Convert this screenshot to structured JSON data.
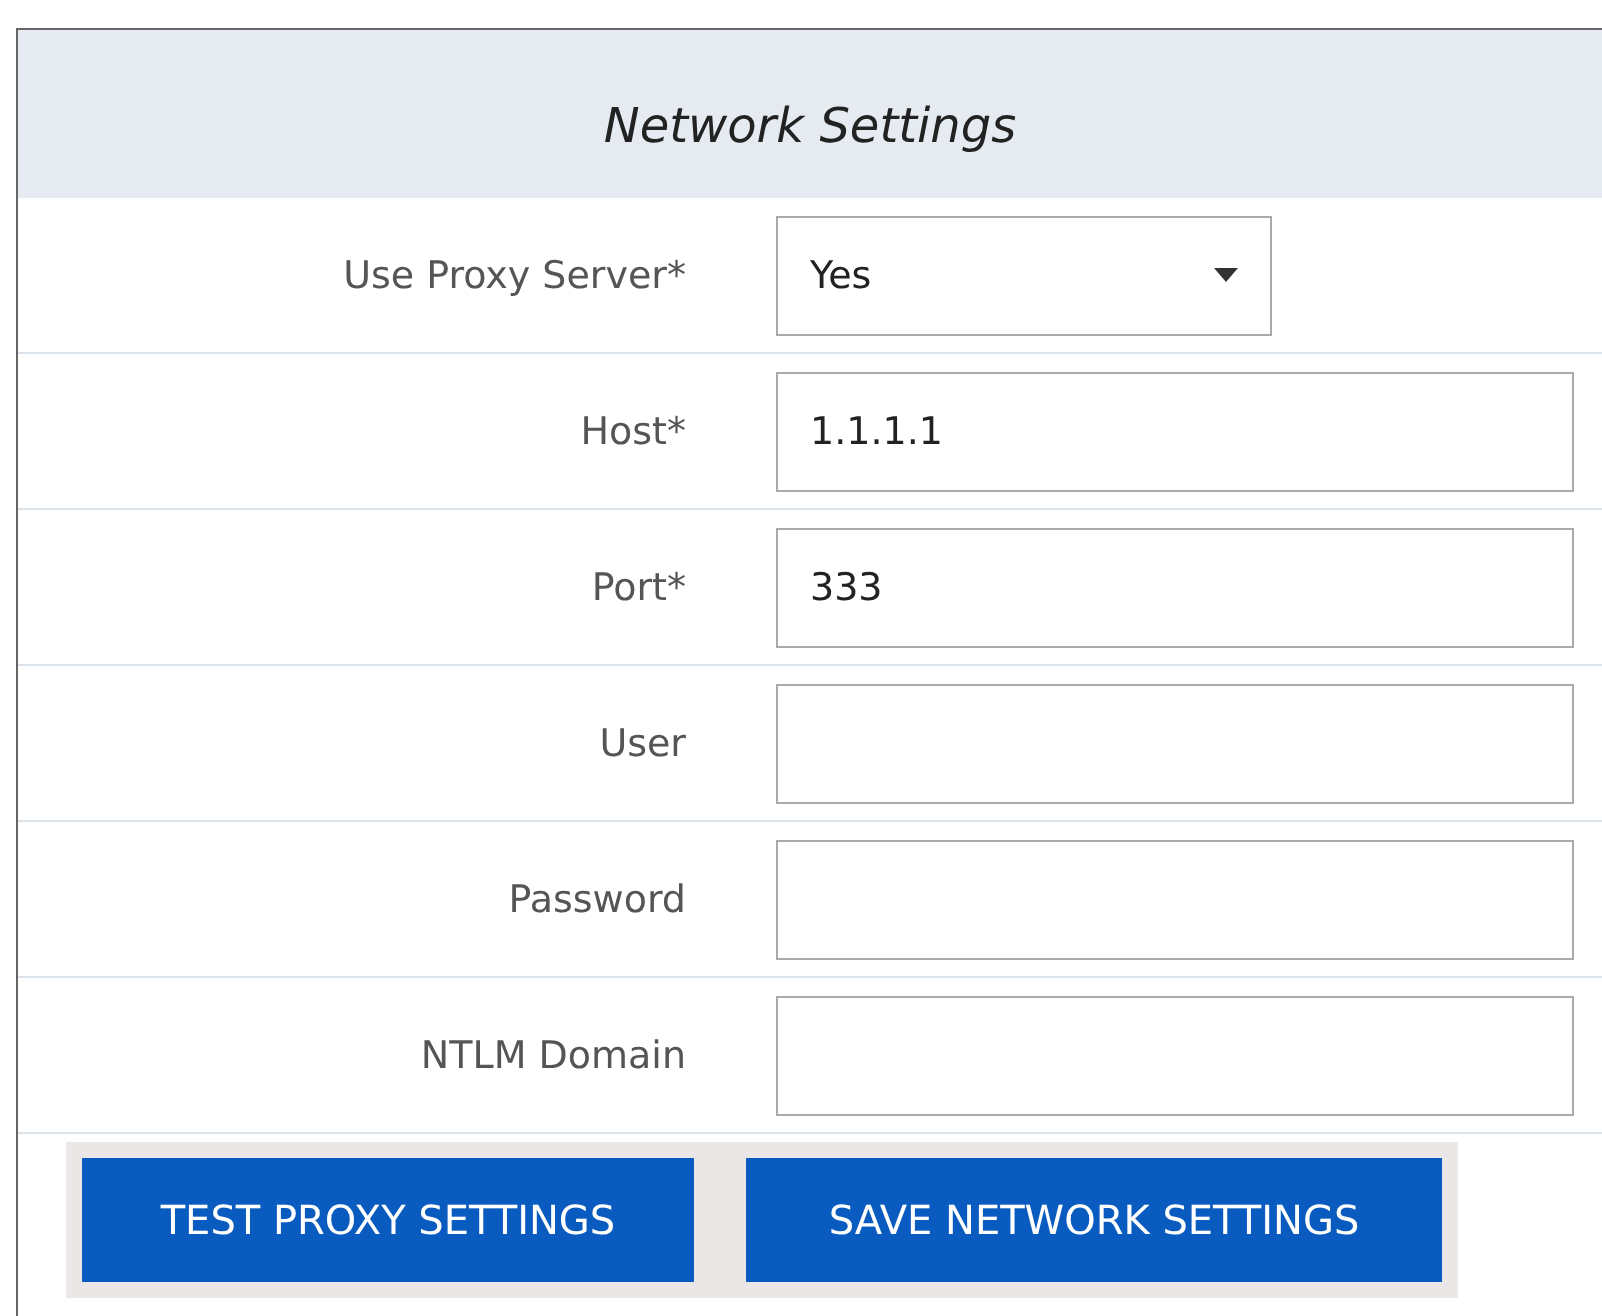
{
  "panel": {
    "title": "Network Settings"
  },
  "fields": [
    {
      "kind": "select",
      "label": "Use Proxy Server*",
      "value": "Yes"
    },
    {
      "kind": "text",
      "label": "Host*",
      "value": "1.1.1.1"
    },
    {
      "kind": "text",
      "label": "Port*",
      "value": "333"
    },
    {
      "kind": "text",
      "label": "User"
    },
    {
      "kind": "password",
      "label": "Password"
    },
    {
      "kind": "text",
      "label": "NTLM Domain"
    }
  ],
  "buttons": [
    "TEST PROXY SETTINGS",
    "SAVE NETWORK SETTINGS"
  ]
}
